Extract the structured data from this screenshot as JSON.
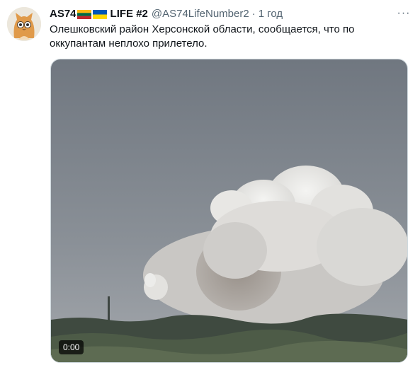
{
  "tweet": {
    "author_name": "AS74",
    "author_name_suffix": "LIFE #2",
    "handle": "@AS74LifeNumber2",
    "separator": "·",
    "time": "1 год",
    "text": "Олешковский район Херсонской области, сообщается, что по оккупантам неплохо прилетело.",
    "more_label": "···",
    "video_timestamp": "0:00"
  },
  "icons": {
    "avatar": "cat-avatar-icon",
    "flag_1": "lithuania-flag-icon",
    "flag_2": "ukraine-flag-icon",
    "more": "more-options-icon"
  },
  "colors": {
    "text_primary": "#0f1419",
    "text_secondary": "#536471",
    "media_border": "#cfd9de"
  }
}
